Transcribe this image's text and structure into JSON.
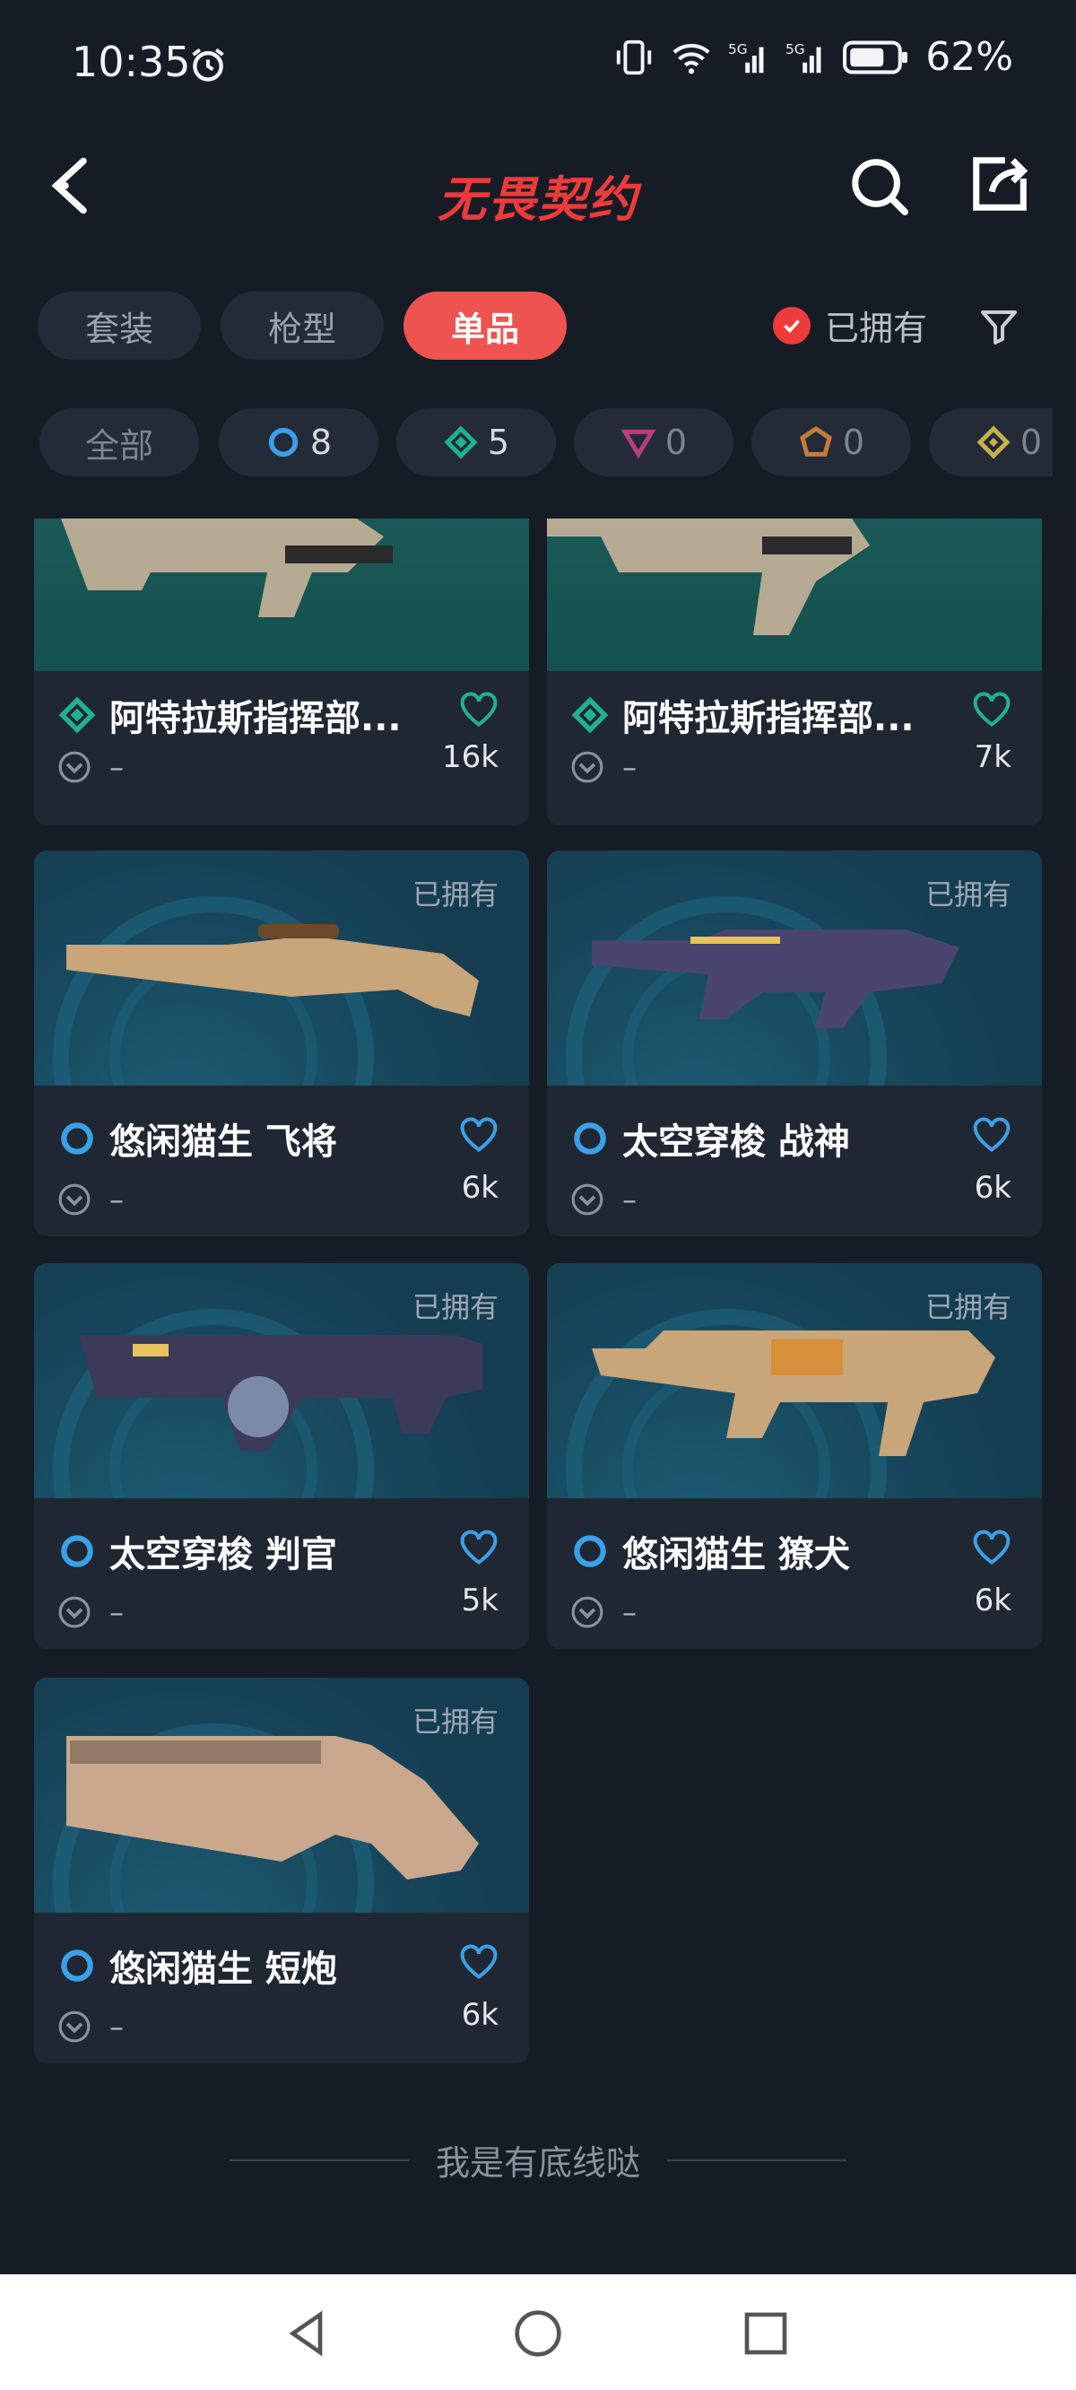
{
  "status": {
    "time": "10:35",
    "battery": "62%"
  },
  "nav": {
    "title": "无畏契约"
  },
  "tabs": [
    {
      "label": "套装"
    },
    {
      "label": "枪型"
    },
    {
      "label": "单品"
    }
  ],
  "owned_filter": {
    "label": "已拥有"
  },
  "rarity_chips": [
    {
      "label": "全部"
    },
    {
      "count": "8",
      "icon": "select-tier-icon",
      "color": "#3aa0e8"
    },
    {
      "count": "5",
      "icon": "deluxe-tier-icon",
      "color": "#1fb28f"
    },
    {
      "count": "0",
      "icon": "premium-tier-icon",
      "color": "#b5407a"
    },
    {
      "count": "0",
      "icon": "exclusive-tier-icon",
      "color": "#c77b37"
    },
    {
      "count": "0",
      "icon": "ultra-tier-icon",
      "color": "#c7b04a"
    }
  ],
  "items": [
    {
      "title": "阿特拉斯指挥部...",
      "owned": "",
      "sub": "–",
      "count": "16k",
      "tier": "deluxe"
    },
    {
      "title": "阿特拉斯指挥部...",
      "owned": "",
      "sub": "–",
      "count": "7k",
      "tier": "deluxe"
    },
    {
      "title": "悠闲猫生 飞将",
      "owned": "已拥有",
      "sub": "–",
      "count": "6k",
      "tier": "select"
    },
    {
      "title": "太空穿梭 战神",
      "owned": "已拥有",
      "sub": "–",
      "count": "6k",
      "tier": "select"
    },
    {
      "title": "太空穿梭 判官",
      "owned": "已拥有",
      "sub": "–",
      "count": "5k",
      "tier": "select"
    },
    {
      "title": "悠闲猫生 獠犬",
      "owned": "已拥有",
      "sub": "–",
      "count": "6k",
      "tier": "select"
    },
    {
      "title": "悠闲猫生 短炮",
      "owned": "已拥有",
      "sub": "–",
      "count": "6k",
      "tier": "select"
    }
  ],
  "footer": {
    "text": "我是有底线哒"
  }
}
